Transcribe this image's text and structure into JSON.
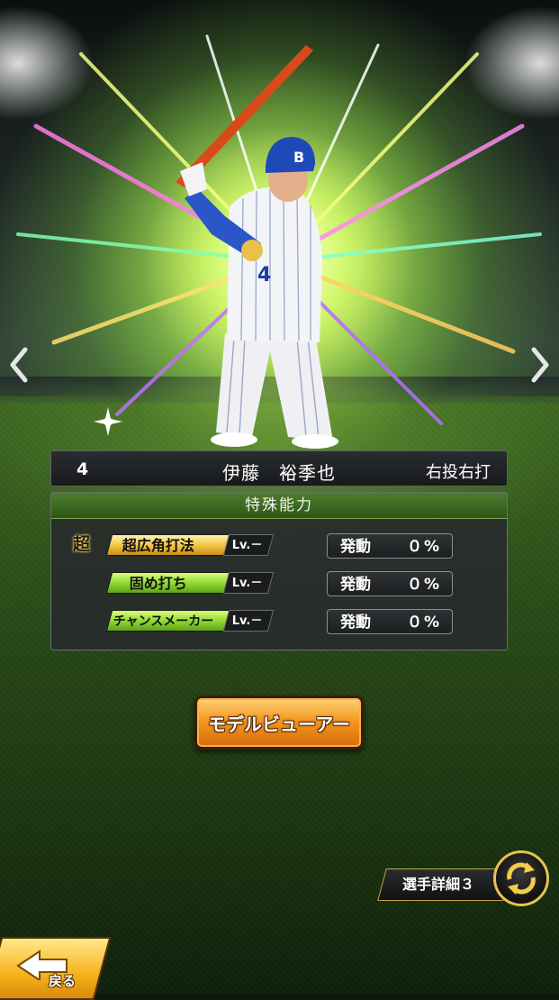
{
  "player": {
    "number": "4",
    "name": "伊藤　裕季也",
    "throw_bat": "右投右打",
    "uniform_number": "4",
    "cap_logo": "B"
  },
  "abilities": {
    "header": "特殊能力",
    "super_badge": "超",
    "items": [
      {
        "name": "超広角打法",
        "level": "Lv.－",
        "effect_label": "発動",
        "effect_value": "０%",
        "tier": "gold"
      },
      {
        "name": "固め打ち",
        "level": "Lv.－",
        "effect_label": "発動",
        "effect_value": "０%",
        "tier": "green"
      },
      {
        "name": "チャンスメーカー",
        "level": "Lv.－",
        "effect_label": "発動",
        "effect_value": "０%",
        "tier": "green"
      }
    ]
  },
  "buttons": {
    "model_viewer": "モデルビューアー",
    "player_detail": "選手詳細３",
    "back": "戻る"
  },
  "icons": {
    "prev": "chevron-left-icon",
    "next": "chevron-right-icon",
    "swap": "swap-arrows-icon",
    "back": "back-arrow-icon"
  },
  "colors": {
    "accent_gold": "#f0c23c",
    "accent_green": "#8cd52e",
    "button_orange": "#f59a22",
    "header_green": "#3d6a22"
  }
}
